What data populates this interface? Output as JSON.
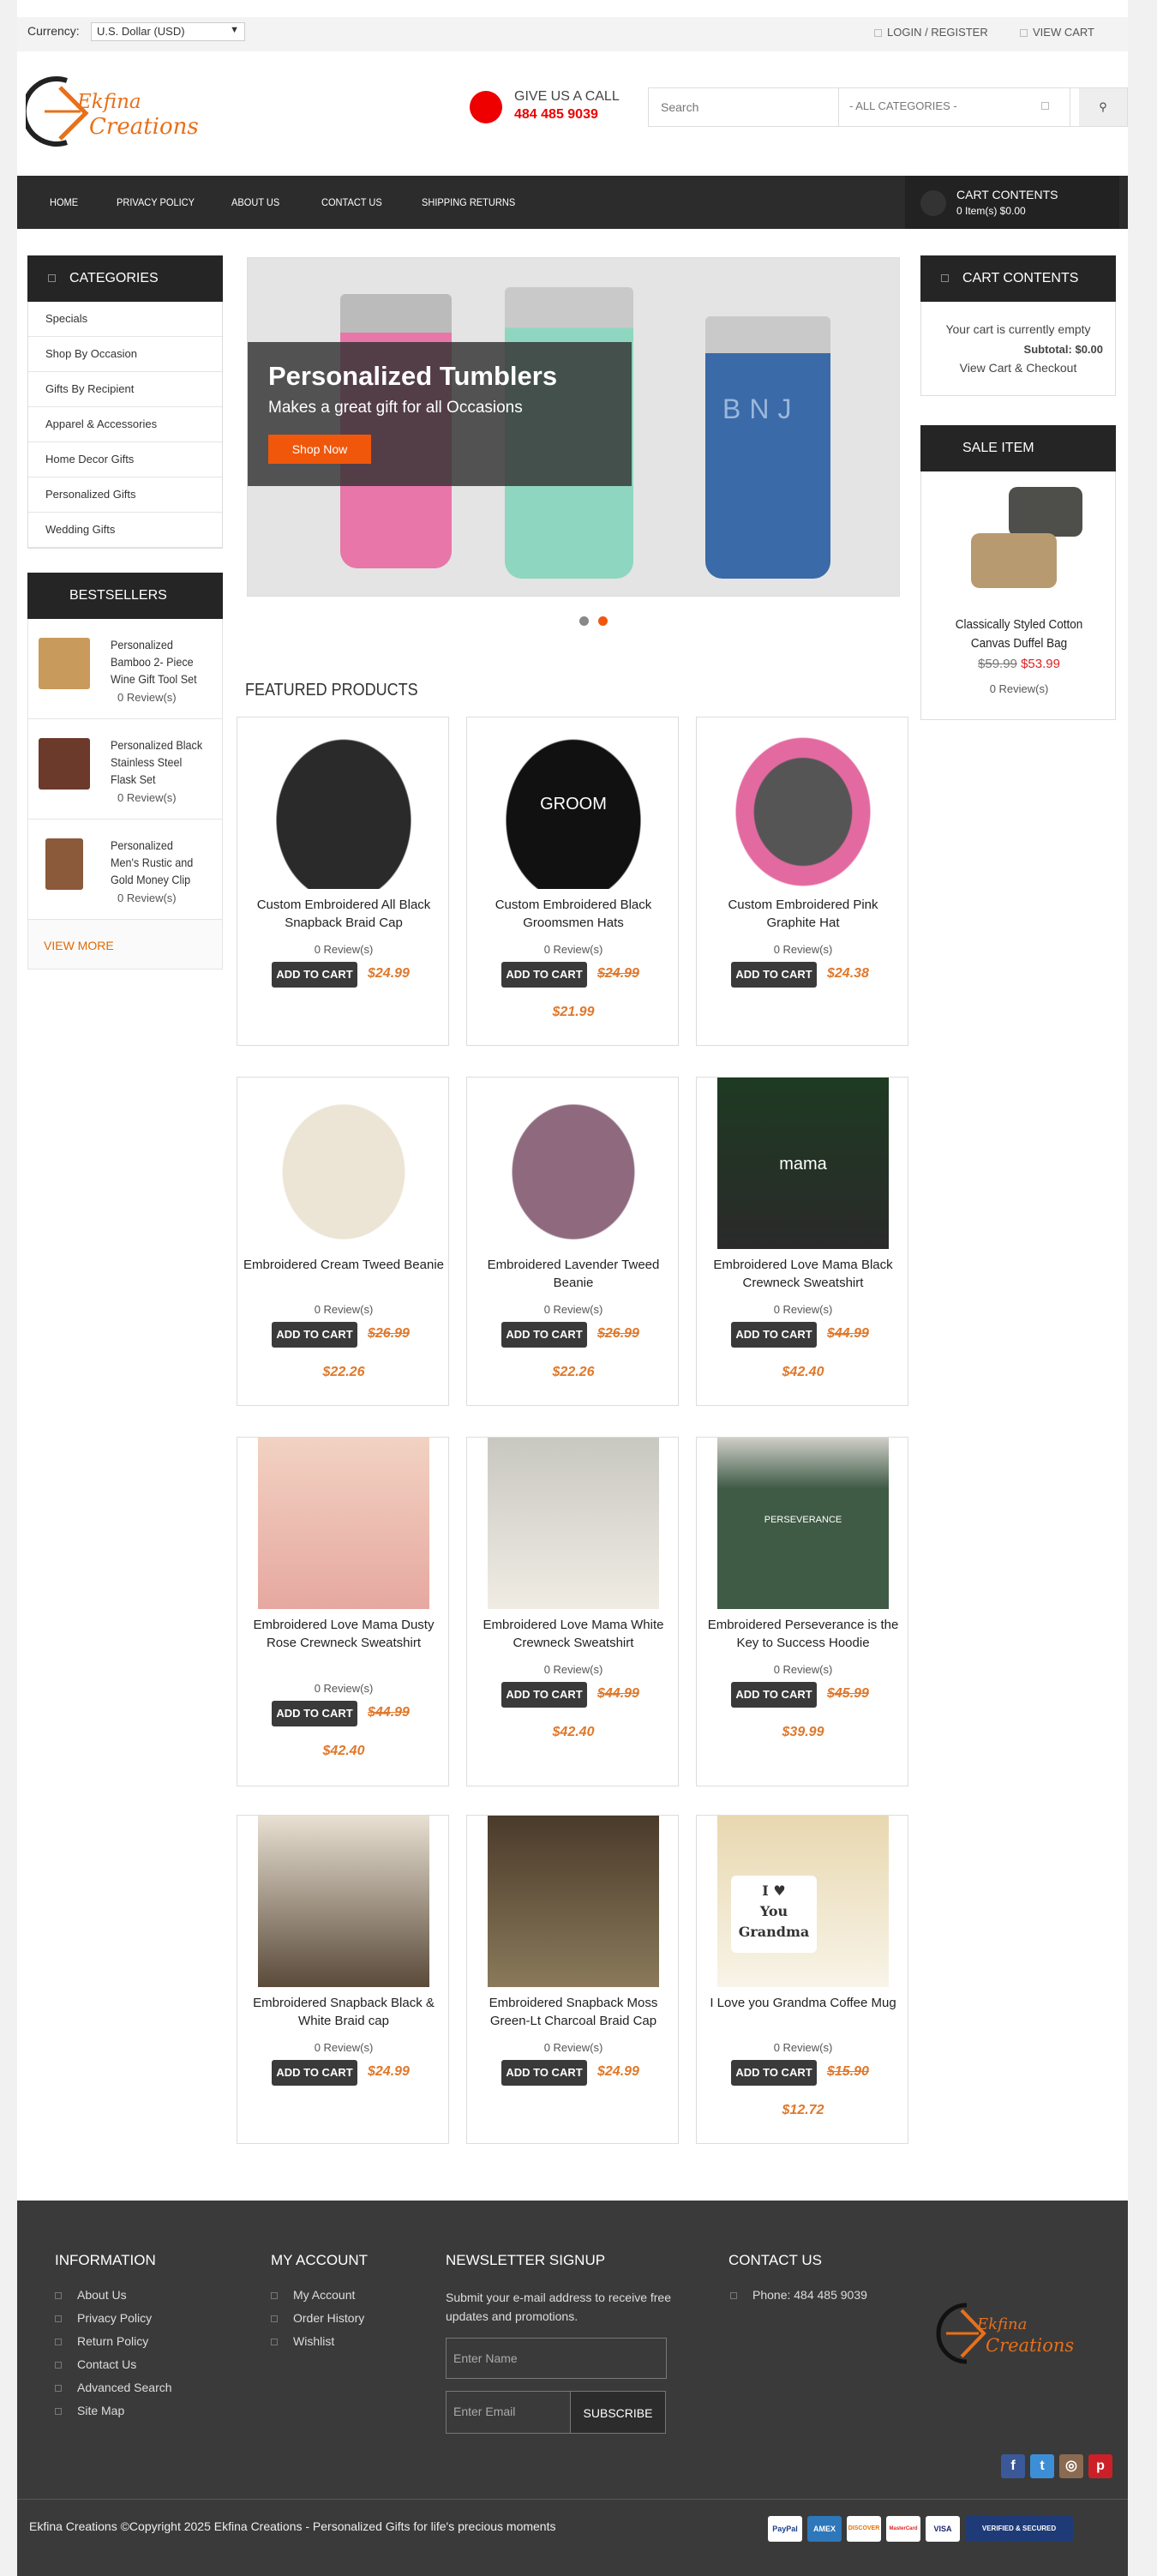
{
  "topbar": {
    "currency_label": "Currency:",
    "currency_value": "U.S. Dollar (USD)",
    "login_label": "LOGIN / REGISTER",
    "viewcart_label": "VIEW CART"
  },
  "header": {
    "logo_text_1": "Ekfina",
    "logo_text_2": "Creations",
    "call_title": "GIVE US A CALL",
    "call_number": "484 485 9039",
    "search_placeholder": "Search",
    "category_select": "- ALL CATEGORIES -"
  },
  "nav": {
    "items": [
      "HOME",
      "PRIVACY POLICY",
      "ABOUT US",
      "CONTACT US",
      "SHIPPING RETURNS"
    ],
    "cart_title": "CART CONTENTS",
    "cart_items": "0 Item(s) $0.00"
  },
  "categories": {
    "title": "CATEGORIES",
    "items": [
      "Specials",
      "Shop By Occasion",
      "Gifts By Recipient",
      "Apparel & Accessories",
      "Home Decor Gifts",
      "Personalized Gifts",
      "Wedding Gifts"
    ]
  },
  "bestsellers": {
    "title": "BESTSELLERS",
    "items": [
      {
        "name": "Personalized Bamboo 2- Piece Wine Gift Tool Set",
        "reviews": "0 Review(s)"
      },
      {
        "name": "Personalized Black Stainless Steel Flask Set",
        "reviews": "0 Review(s)"
      },
      {
        "name": "Personalized Men's Rustic and Gold Money Clip",
        "reviews": "0 Review(s)"
      }
    ],
    "view_more": "VIEW MORE"
  },
  "slider": {
    "title": "Personalized Tumblers",
    "subtitle": "Makes a great gift for all Occasions",
    "button": "Shop Now",
    "tumbler_text": "BNJ"
  },
  "featured": {
    "title": "FEATURED PRODUCTS",
    "add_to_cart": "ADD TO CART",
    "products": [
      {
        "name": "Custom Embroidered All Black Snapback Braid Cap",
        "reviews": "0 Review(s)",
        "old_price": "$24.99",
        "new_price": "",
        "img": "cap-black"
      },
      {
        "name": "Custom Embroidered Black Groomsmen Hats",
        "reviews": "0 Review(s)",
        "old_price": "$24.99",
        "new_price": "$21.99",
        "img": "cap-groom",
        "img_text": "GROOM"
      },
      {
        "name": "Custom Embroidered Pink Graphite Hat",
        "reviews": "0 Review(s)",
        "old_price": "$24.38",
        "new_price": "",
        "img": "cap-pink"
      },
      {
        "name": "Embroidered Cream Tweed Beanie",
        "reviews": "0 Review(s)",
        "old_price": "$26.99",
        "new_price": "$22.26",
        "img": "beanie-cream"
      },
      {
        "name": "Embroidered Lavender Tweed Beanie",
        "reviews": "0 Review(s)",
        "old_price": "$26.99",
        "new_price": "$22.26",
        "img": "beanie-lavender"
      },
      {
        "name": "Embroidered Love Mama Black Crewneck Sweatshirt",
        "reviews": "0 Review(s)",
        "old_price": "$44.99",
        "new_price": "$42.40",
        "img": "sweat-black",
        "img_text": "mama"
      },
      {
        "name": "Embroidered Love Mama Dusty Rose Crewneck Sweatshirt",
        "reviews": "0 Review(s)",
        "old_price": "$44.99",
        "new_price": "$42.40",
        "img": "sweat-rose"
      },
      {
        "name": "Embroidered Love Mama White Crewneck Sweatshirt",
        "reviews": "0 Review(s)",
        "old_price": "$44.99",
        "new_price": "$42.40",
        "img": "sweat-white"
      },
      {
        "name": "Embroidered Perseverance is the Key to Success Hoodie",
        "reviews": "0 Review(s)",
        "old_price": "$45.99",
        "new_price": "$39.99",
        "img": "hoodie-green",
        "img_text": "PERSEVERANCE"
      },
      {
        "name": "Embroidered Snapback Black & White Braid cap",
        "reviews": "0 Review(s)",
        "old_price": "$24.99",
        "new_price": "",
        "img": "cap-bw"
      },
      {
        "name": "Embroidered Snapback Moss Green-Lt Charcoal Braid Cap",
        "reviews": "0 Review(s)",
        "old_price": "$24.99",
        "new_price": "",
        "img": "cap-moss"
      },
      {
        "name": "I Love you Grandma Coffee Mug",
        "reviews": "0 Review(s)",
        "old_price": "$15.90",
        "new_price": "$12.72",
        "img": "mug",
        "img_text_1": "I",
        "img_text_2": "You",
        "img_text_3": "Grandma"
      }
    ]
  },
  "cart_box": {
    "title": "CART CONTENTS",
    "empty": "Your cart is currently empty",
    "subtotal": "Subtotal: $0.00",
    "checkout": "View Cart & Checkout"
  },
  "sale": {
    "title": "SALE ITEM",
    "name": "Classically Styled Cotton Canvas Duffel Bag",
    "old_price": "$59.99",
    "new_price": "$53.99",
    "reviews": "0 Review(s)"
  },
  "footer": {
    "info_title": "INFORMATION",
    "info_links": [
      "About Us",
      "Privacy Policy",
      "Return Policy",
      "Contact Us",
      "Advanced Search",
      "Site Map"
    ],
    "account_title": "MY ACCOUNT",
    "account_links": [
      "My Account",
      "Order History",
      "Wishlist"
    ],
    "newsletter_title": "NEWSLETTER SIGNUP",
    "newsletter_text": "Submit your e-mail address to receive free updates and promotions.",
    "name_placeholder": "Enter Name",
    "email_placeholder": "Enter Email",
    "subscribe": "SUBSCRIBE",
    "contact_title": "CONTACT US",
    "phone": "Phone: 484 485 9039",
    "copyright": "Ekfina Creations ©Copyright 2025 Ekfina Creations   - Personalized Gifts for life's precious moments",
    "payments": [
      "PayPal",
      "AMEX",
      "DISCOVER",
      "MasterCard",
      "VISA",
      "VERIFIED & SECURED"
    ]
  },
  "colors": {
    "accent": "#f0570b",
    "price": "#e0782a",
    "dark": "#252525"
  }
}
